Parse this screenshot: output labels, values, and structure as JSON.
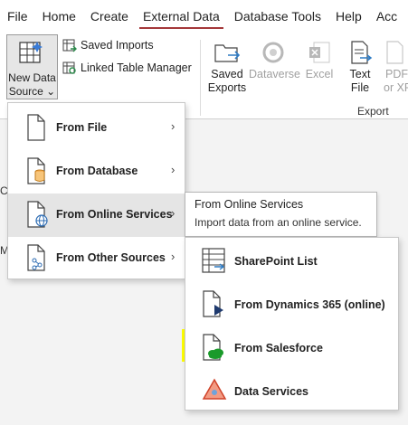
{
  "menubar": {
    "tabs": [
      {
        "label": "File"
      },
      {
        "label": "Home"
      },
      {
        "label": "Create"
      },
      {
        "label": "External Data",
        "active": true
      },
      {
        "label": "Database Tools"
      },
      {
        "label": "Help"
      },
      {
        "label": "Acc"
      }
    ]
  },
  "ribbon": {
    "new_data_source": "New Data Source",
    "new_data_source_line1": "New Data",
    "new_data_source_line2": "Source",
    "saved_imports": "Saved Imports",
    "linked_table_manager": "Linked Table Manager",
    "saved_exports_line1": "Saved",
    "saved_exports_line2": "Exports",
    "dataverse": "Dataverse",
    "excel": "Excel",
    "text_file_line1": "Text",
    "text_file_line2": "File",
    "pdf_line1": "PDF",
    "pdf_line2": "or XP",
    "export_group_label": "Export"
  },
  "dropdown": {
    "items": [
      {
        "label": "From File"
      },
      {
        "label": "From Database"
      },
      {
        "label": "From Online Services",
        "highlighted": true
      },
      {
        "label": "From Other Sources"
      }
    ]
  },
  "tooltip": {
    "title": "From Online Services",
    "description": "Import data from an online service."
  },
  "submenu": {
    "items": [
      {
        "label": "SharePoint List"
      },
      {
        "label": "From Dynamics 365 (online)"
      },
      {
        "label": "From Salesforce",
        "highlighted": true
      },
      {
        "label": "Data Services"
      }
    ]
  },
  "left_pane": {
    "letters": [
      "C",
      "M"
    ]
  },
  "colors": {
    "active_tab_underline": "#a4373a",
    "highlight_yellow": "#ffff00",
    "salesforce_green": "#1a9a2a",
    "dynamics_blue": "#1f3a6e"
  }
}
